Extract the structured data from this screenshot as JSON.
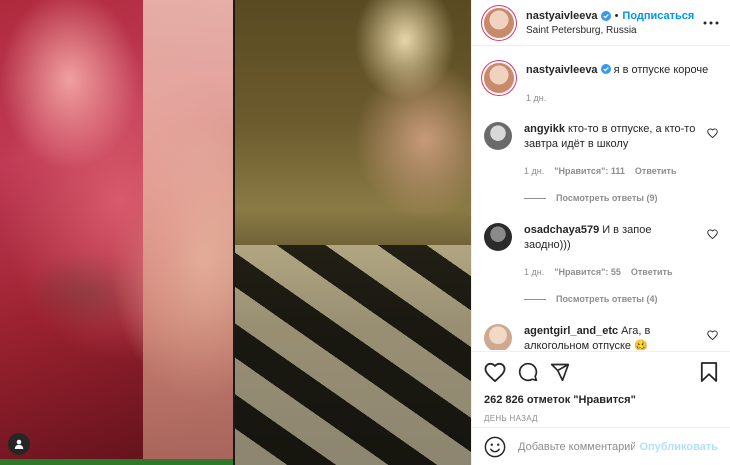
{
  "header": {
    "username": "nastyaivleeva",
    "separator": "•",
    "follow_label": "Подписаться",
    "location": "Saint Petersburg, Russia"
  },
  "caption": {
    "username": "nastyaivleeva",
    "text": "я в отпуске короче",
    "time": "1 дн."
  },
  "comments": [
    {
      "username": "angyikk",
      "text": "кто-то в отпуске, а кто-то завтра идёт в школу",
      "time": "1 дн.",
      "likes": "\"Нравится\": 111",
      "reply_label": "Ответить",
      "view_replies": "Посмотреть ответы (9)"
    },
    {
      "username": "osadchaya579",
      "text": "И в запое заодно)))",
      "time": "1 дн.",
      "likes": "\"Нравится\": 55",
      "reply_label": "Ответить",
      "view_replies": "Посмотреть ответы (4)"
    },
    {
      "username": "agentgirl_and_etc",
      "text": "Ага, в алкогольном отпуске",
      "emoji": "🥴"
    }
  ],
  "actions": {
    "likes_text": "262 826 отметок \"Нравится\"",
    "time_ago": "День назад"
  },
  "add_comment": {
    "placeholder": "Добавьте комментарий...",
    "publish_label": "Опубликовать"
  },
  "icons": [
    "user-tag-icon",
    "verified-icon",
    "more-options-icon",
    "heart-icon",
    "comment-icon",
    "share-icon",
    "bookmark-icon",
    "emoji-icon"
  ],
  "colors": {
    "accent": "#0095f6",
    "publish_disabled": "#b2dffc",
    "muted": "#8e8e8e"
  }
}
